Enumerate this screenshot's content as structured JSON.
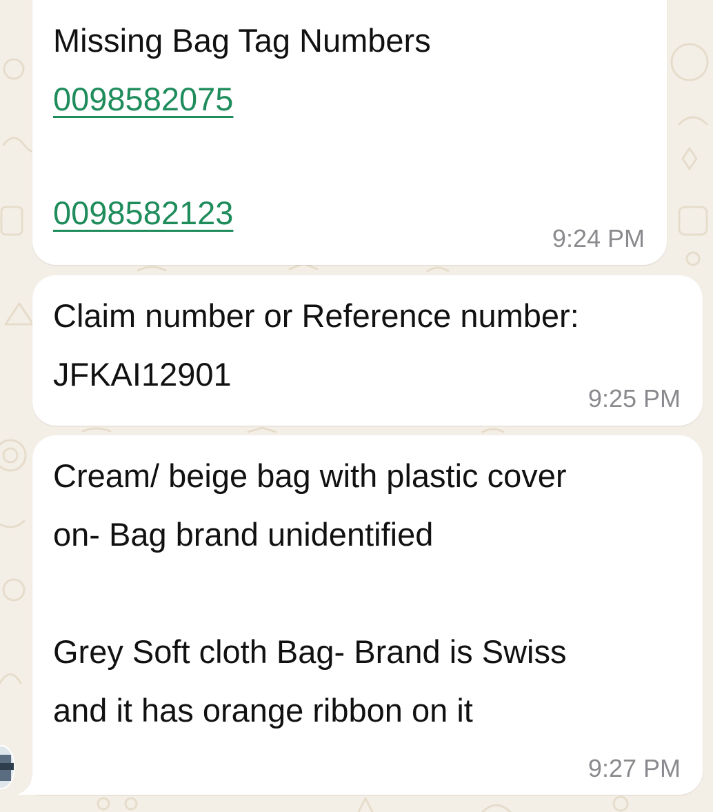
{
  "messages": [
    {
      "heading": "Missing Bag Tag Numbers",
      "links": [
        "0098582075",
        "0098582123"
      ],
      "time": "9:24 PM"
    },
    {
      "line1": "Claim number or Reference number:",
      "line2": "JFKAI12901",
      "time": "9:25 PM"
    },
    {
      "lines": [
        "Cream/ beige bag with plastic cover",
        "on- Bag brand unidentified",
        "Grey Soft cloth Bag- Brand is Swiss",
        "and it has orange ribbon on it"
      ],
      "time": "9:27 PM"
    }
  ],
  "colors": {
    "link": "#1f8c5c",
    "wallpaper": "#f4efe6",
    "bubble": "#ffffff",
    "timestamp": "#8a8a8e"
  }
}
